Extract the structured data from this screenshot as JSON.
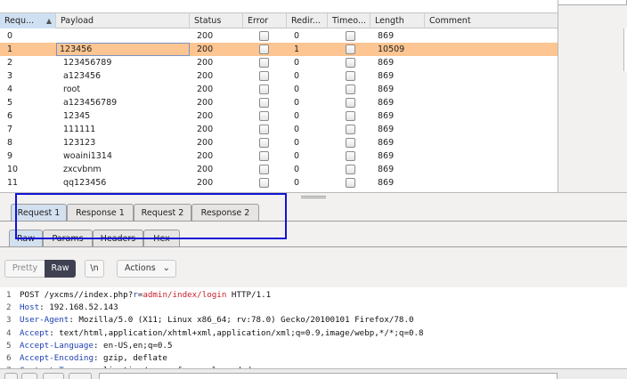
{
  "results": {
    "columns": [
      "Requ...",
      "Payload",
      "Status",
      "Error",
      "Redir...",
      "Timeo...",
      "Length",
      "Comment"
    ],
    "rows": [
      {
        "req": "0",
        "payload": "",
        "status": "200",
        "redir": "0",
        "length": "869"
      },
      {
        "req": "1",
        "payload": "123456",
        "status": "200",
        "redir": "1",
        "length": "10509"
      },
      {
        "req": "2",
        "payload": "123456789",
        "status": "200",
        "redir": "0",
        "length": "869"
      },
      {
        "req": "3",
        "payload": "a123456",
        "status": "200",
        "redir": "0",
        "length": "869"
      },
      {
        "req": "4",
        "payload": "root",
        "status": "200",
        "redir": "0",
        "length": "869"
      },
      {
        "req": "5",
        "payload": "a123456789",
        "status": "200",
        "redir": "0",
        "length": "869"
      },
      {
        "req": "6",
        "payload": "12345",
        "status": "200",
        "redir": "0",
        "length": "869"
      },
      {
        "req": "7",
        "payload": "111111",
        "status": "200",
        "redir": "0",
        "length": "869"
      },
      {
        "req": "8",
        "payload": "123123",
        "status": "200",
        "redir": "0",
        "length": "869"
      },
      {
        "req": "9",
        "payload": "woaini1314",
        "status": "200",
        "redir": "0",
        "length": "869"
      },
      {
        "req": "10",
        "payload": "zxcvbnm",
        "status": "200",
        "redir": "0",
        "length": "869"
      },
      {
        "req": "11",
        "payload": "qq123456",
        "status": "200",
        "redir": "0",
        "length": "869"
      }
    ],
    "selected_row": 1
  },
  "tabs": [
    "Request 1",
    "Response 1",
    "Request 2",
    "Response 2"
  ],
  "subtabs": [
    "Raw",
    "Params",
    "Headers",
    "Hex"
  ],
  "toolbar": {
    "pretty": "Pretty",
    "raw": "Raw",
    "newline": "\\n",
    "actions": "Actions",
    "actions_icon": "chevron-down-icon"
  },
  "editor": {
    "lines": [
      {
        "num": "1",
        "parts": [
          {
            "t": "POST /yxcms//index.php?",
            "c": ""
          },
          {
            "t": "r",
            "c": "k"
          },
          {
            "t": "=",
            "c": ""
          },
          {
            "t": "admin/index/login",
            "c": "red"
          },
          {
            "t": " HTTP/1.1",
            "c": ""
          }
        ]
      },
      {
        "num": "2",
        "parts": [
          {
            "t": "Host",
            "c": "k"
          },
          {
            "t": ": 192.168.52.143",
            "c": ""
          }
        ]
      },
      {
        "num": "3",
        "parts": [
          {
            "t": "User-Agent",
            "c": "k"
          },
          {
            "t": ": Mozilla/5.0 (X11; Linux x86_64; rv:78.0) Gecko/20100101 Firefox/78.0",
            "c": ""
          }
        ]
      },
      {
        "num": "4",
        "parts": [
          {
            "t": "Accept",
            "c": "k"
          },
          {
            "t": ": text/html,application/xhtml+xml,application/xml;q=0.9,image/webp,*/*;q=0.8",
            "c": ""
          }
        ]
      },
      {
        "num": "5",
        "parts": [
          {
            "t": "Accept-Language",
            "c": "k"
          },
          {
            "t": ": en-US,en;q=0.5",
            "c": ""
          }
        ]
      },
      {
        "num": "6",
        "parts": [
          {
            "t": "Accept-Encoding",
            "c": "k"
          },
          {
            "t": ": gzip, deflate",
            "c": ""
          }
        ]
      },
      {
        "num": "7",
        "parts": [
          {
            "t": "Content-Type",
            "c": "k"
          },
          {
            "t": ": application/x-www-form-urlencoded",
            "c": ""
          }
        ]
      }
    ]
  },
  "colors": {
    "selected_row": "#fcc591",
    "highlight_box": "#1212d6",
    "header_keyword": "#1d3fb2",
    "url_path": "#c71e2b"
  }
}
